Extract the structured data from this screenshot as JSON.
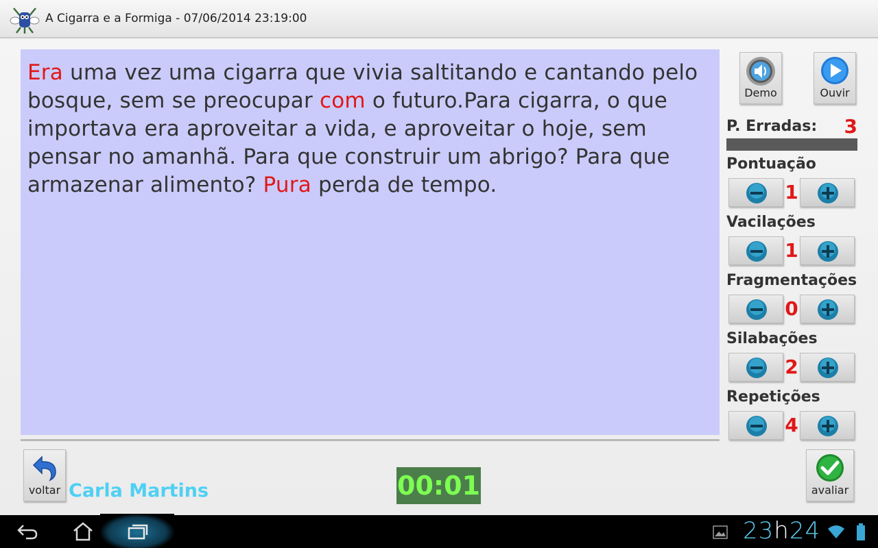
{
  "titlebar": {
    "title": "A Cigarra e a Formiga - 07/06/2014 23:19:00",
    "logo_icon": "ant-mascot-icon"
  },
  "story": {
    "segments": [
      {
        "text": "Era",
        "error": true
      },
      {
        "text": " uma vez uma cigarra que vivia saltitando e cantando pelo bosque, sem se preocupar ",
        "error": false
      },
      {
        "text": "com",
        "error": true
      },
      {
        "text": " o futuro.Para cigarra, o que importava era aproveitar a vida, e aproveitar o hoje, sem pensar no amanhã. Para que construir um abrigo? Para que armazenar alimento? ",
        "error": false
      },
      {
        "text": "Pura",
        "error": true
      },
      {
        "text": " perda de tempo.",
        "error": false
      }
    ],
    "background": "#cbcbfb",
    "error_color": "#e01818"
  },
  "toolbar": {
    "demo_label": "Demo",
    "demo_icon": "speaker-icon",
    "listen_label": "Ouvir",
    "listen_icon": "play-icon"
  },
  "errors": {
    "label": "P. Erradas:",
    "value": "3"
  },
  "categories": [
    {
      "label": "Pontuação",
      "value": "1"
    },
    {
      "label": "Vacilações",
      "value": "1"
    },
    {
      "label": "Fragmentações",
      "value": "0"
    },
    {
      "label": "Silabações",
      "value": "2"
    },
    {
      "label": "Repetições",
      "value": "4"
    }
  ],
  "bottom": {
    "back_label": "voltar",
    "back_icon": "undo-arrow-icon",
    "student_name": "Carla Martins",
    "timer": "00:01",
    "evaluate_label": "avaliar",
    "evaluate_icon": "checkmark-icon"
  },
  "system_bar": {
    "clock_hours": "23",
    "clock_sep": "h",
    "clock_minutes": "24",
    "icons": [
      "back-icon",
      "home-icon",
      "recent-apps-icon",
      "gallery-icon",
      "wifi-icon",
      "battery-icon"
    ]
  },
  "colors": {
    "accent_name": "#4fd0f4",
    "timer_bg": "#4c7e4c",
    "timer_text": "#7dff52",
    "clock": "#5ecbef"
  }
}
